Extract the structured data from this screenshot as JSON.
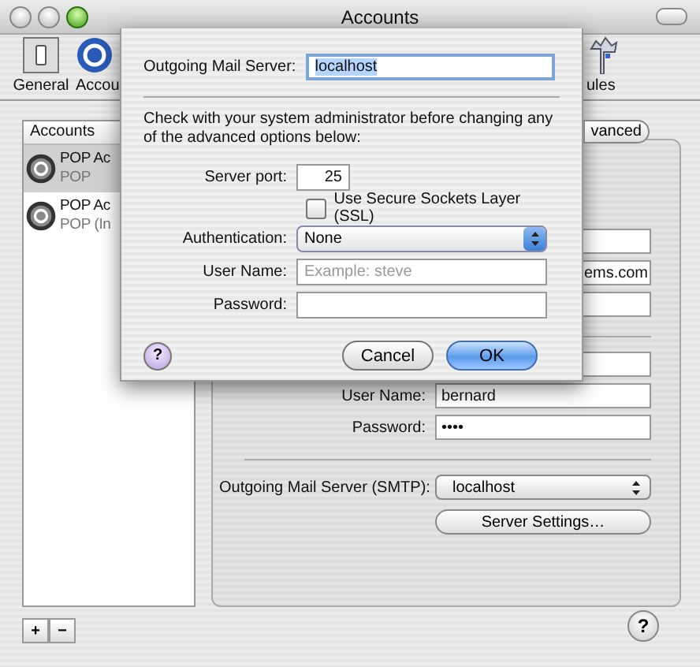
{
  "window": {
    "title": "Accounts"
  },
  "toolbar": [
    {
      "kind": "general",
      "label": "General"
    },
    {
      "kind": "accounts",
      "label": "Accou"
    },
    {
      "kind": "rules",
      "label": "ules"
    }
  ],
  "accounts_list": {
    "header": "Accounts",
    "items": [
      {
        "name": "POP Ac",
        "type": "POP",
        "selected": true
      },
      {
        "name": "POP Ac",
        "type": "POP (In",
        "selected": false
      }
    ]
  },
  "tab": {
    "label": "vanced"
  },
  "account_rows": [
    {
      "kind": "field"
    },
    {
      "kind": "field",
      "value": "ems.com"
    },
    {
      "kind": "field"
    },
    {
      "kind": "separator"
    },
    {
      "kind": "field"
    },
    {
      "kind": "field",
      "label": "User Name:",
      "value": "bernard"
    },
    {
      "kind": "field",
      "label": "Password:",
      "value": "••••"
    },
    {
      "kind": "separator"
    },
    {
      "kind": "popup",
      "label": "Outgoing Mail Server (SMTP):",
      "value": "localhost"
    },
    {
      "kind": "button",
      "label": "Server Settings…"
    }
  ],
  "list_buttons": [
    "+",
    "−"
  ],
  "help": "?",
  "sheet": {
    "server_label": "Outgoing Mail Server:",
    "server_value": "localhost",
    "server_value_selected": true,
    "note": "Check with your system administrator before changing any of the advanced options below:",
    "port_label": "Server port:",
    "port_value": "25",
    "ssl": {
      "label": "Use Secure Sockets Layer (SSL)",
      "checked": false
    },
    "auth_label": "Authentication:",
    "auth_value": "None",
    "user_label": "User Name:",
    "user_placeholder": "Example: steve",
    "password_label": "Password:",
    "help": "?",
    "buttons": [
      {
        "label": "Cancel",
        "default": false
      },
      {
        "label": "OK",
        "default": true
      }
    ]
  }
}
